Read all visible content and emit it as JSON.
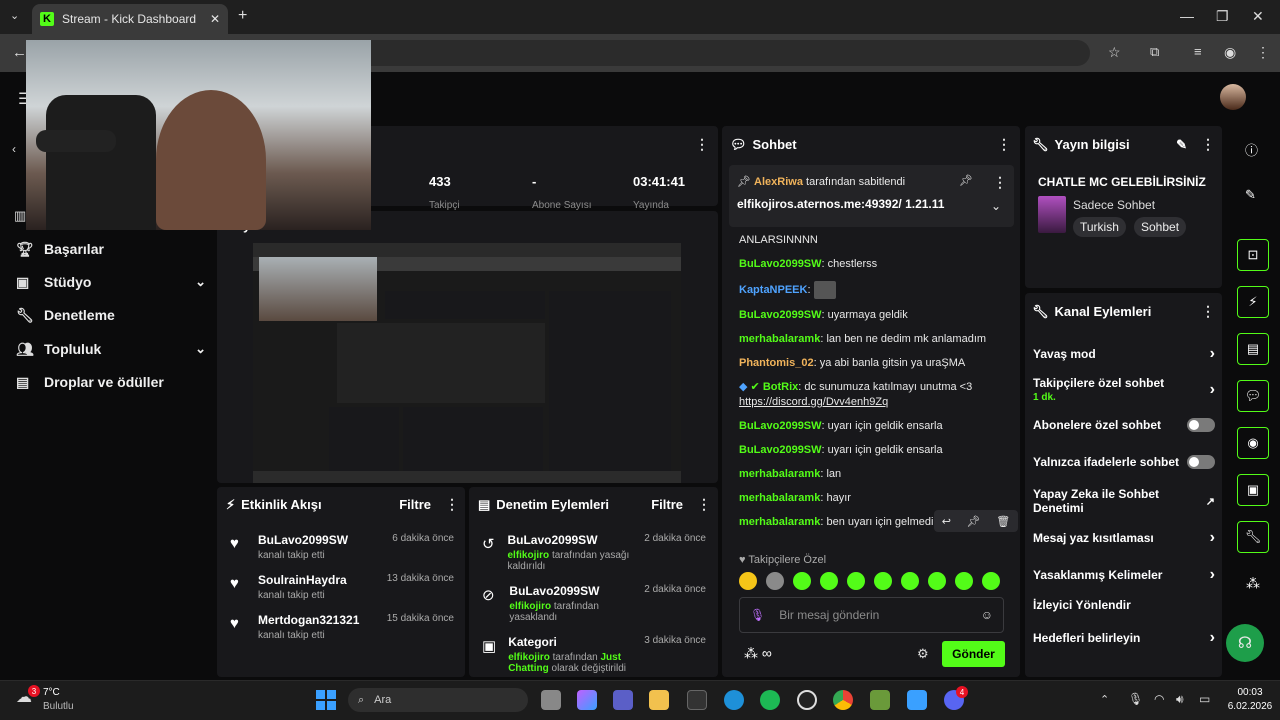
{
  "browser": {
    "tab_title": "Stream - Kick Dashboard"
  },
  "sidebar": {
    "items": [
      {
        "label": "Başarılar",
        "icon": "trophy-icon"
      },
      {
        "label": "Stüdyo",
        "icon": "studio-icon"
      },
      {
        "label": "Denetleme",
        "icon": "wrench-icon"
      },
      {
        "label": "Topluluk",
        "icon": "people-icon"
      },
      {
        "label": "Droplar ve ödüller",
        "icon": "gift-icon"
      }
    ]
  },
  "stats": {
    "a": "433",
    "b": "-",
    "c": "03:41:41",
    "a_label": "Takipçi",
    "b_label": "Abone Sayısı",
    "c_label": "Yayında"
  },
  "preview": {
    "title": "Yayın Önizlemesi"
  },
  "activity": {
    "title": "Etkinlik Akışı",
    "filter": "Filtre",
    "items": [
      {
        "name": "BuLavo2099SW",
        "sub": "kanalı takip etti",
        "time": "6 dakika önce"
      },
      {
        "name": "SoulrainHaydra",
        "sub": "kanalı takip etti",
        "time": "13 dakika önce"
      },
      {
        "name": "Mertdogan321321",
        "sub": "kanalı takip etti",
        "time": "15 dakika önce"
      }
    ]
  },
  "modlog": {
    "title": "Denetim Eylemleri",
    "filter": "Filtre",
    "items": [
      {
        "name": "BuLavo2099SW",
        "actor": "elfikojiro",
        "sub": "tarafından yasağı kaldırıldı",
        "time": "2 dakika önce"
      },
      {
        "name": "BuLavo2099SW",
        "actor": "elfikojiro",
        "sub": "tarafından yasaklandı",
        "time": "2 dakika önce"
      },
      {
        "name": "Kategori",
        "actor": "elfikojiro",
        "sub": "tarafından",
        "extra": "Just Chatting",
        "sub2": "olarak değiştirildi",
        "time": "3 dakika önce"
      }
    ]
  },
  "chat": {
    "title": "Sohbet",
    "pinned_by": "AlexRiwa",
    "pinned_suffix": "tarafından sabitlendi",
    "pinned_text": "elfikojiros.aternos.me:49392/ 1.21.11",
    "messages": [
      {
        "user": "",
        "text": "ANLARSINNNN",
        "color": "#e8e8e8"
      },
      {
        "user": "BuLavo2099SW",
        "text": "chestlerss",
        "color": "#53fc18"
      },
      {
        "user": "KaptaNPEEK",
        "text": "",
        "color": "#4fa3ff"
      },
      {
        "user": "BuLavo2099SW",
        "text": "uyarmaya geldik",
        "color": "#53fc18"
      },
      {
        "user": "merhabalaramk",
        "text": "lan ben ne dedim mk anlamadım",
        "color": "#53fc18"
      },
      {
        "user": "Phantomis_02",
        "text": "ya abi banla gitsin ya uraŞMA",
        "color": "#f0b35b"
      },
      {
        "user": "BotRix",
        "text": "dc sunumuza katılmayı unutma <3",
        "color": "#53fc18",
        "link": "https://discord.gg/Dvv4enh9Zq"
      },
      {
        "user": "BuLavo2099SW",
        "text": "uyarı için geldik ensarla",
        "color": "#53fc18"
      },
      {
        "user": "BuLavo2099SW",
        "text": "uyarı için geldik ensarla",
        "color": "#53fc18"
      },
      {
        "user": "merhabalaramk",
        "text": "lan",
        "color": "#53fc18"
      },
      {
        "user": "merhabalaramk",
        "text": "hayır",
        "color": "#53fc18"
      },
      {
        "user": "merhabalaramk",
        "text": "ben uyarı için gelmedim amk",
        "color": "#53fc18"
      }
    ],
    "followers_only": "Takipçilere Özel",
    "input_placeholder": "Bir mesaj gönderin",
    "send_label": "Gönder"
  },
  "stream_info": {
    "title": "Yayın bilgisi",
    "stream_title": "CHATLE MC GELEBİLİRSİNİZ",
    "category": "Sadece Sohbet",
    "tags": [
      "Turkish",
      "Sohbet"
    ]
  },
  "channel_actions": {
    "title": "Kanal Eylemleri",
    "items": [
      {
        "label": "Yavaş mod",
        "kind": "arrow"
      },
      {
        "label": "Takipçilere özel sohbet",
        "sub": "1 dk.",
        "kind": "arrow"
      },
      {
        "label": "Abonelere özel sohbet",
        "kind": "toggle"
      },
      {
        "label": "Yalnızca ifadelerle sohbet",
        "kind": "toggle"
      },
      {
        "label": "Yapay Zeka ile Sohbet Denetimi",
        "kind": "external"
      },
      {
        "label": "Mesaj yaz kısıtlaması",
        "kind": "arrow"
      },
      {
        "label": "Yasaklanmış Kelimeler",
        "kind": "arrow"
      },
      {
        "label": "İzleyici Yönlendir",
        "kind": "none"
      },
      {
        "label": "Hedefleri belirleyin",
        "kind": "arrow"
      }
    ]
  },
  "taskbar": {
    "weather_temp": "7°C",
    "weather_desc": "Bulutlu",
    "weather_badge": "3",
    "search_placeholder": "Ara",
    "time": "00:03",
    "date": "6.02.2026",
    "discord_badge": "4"
  }
}
